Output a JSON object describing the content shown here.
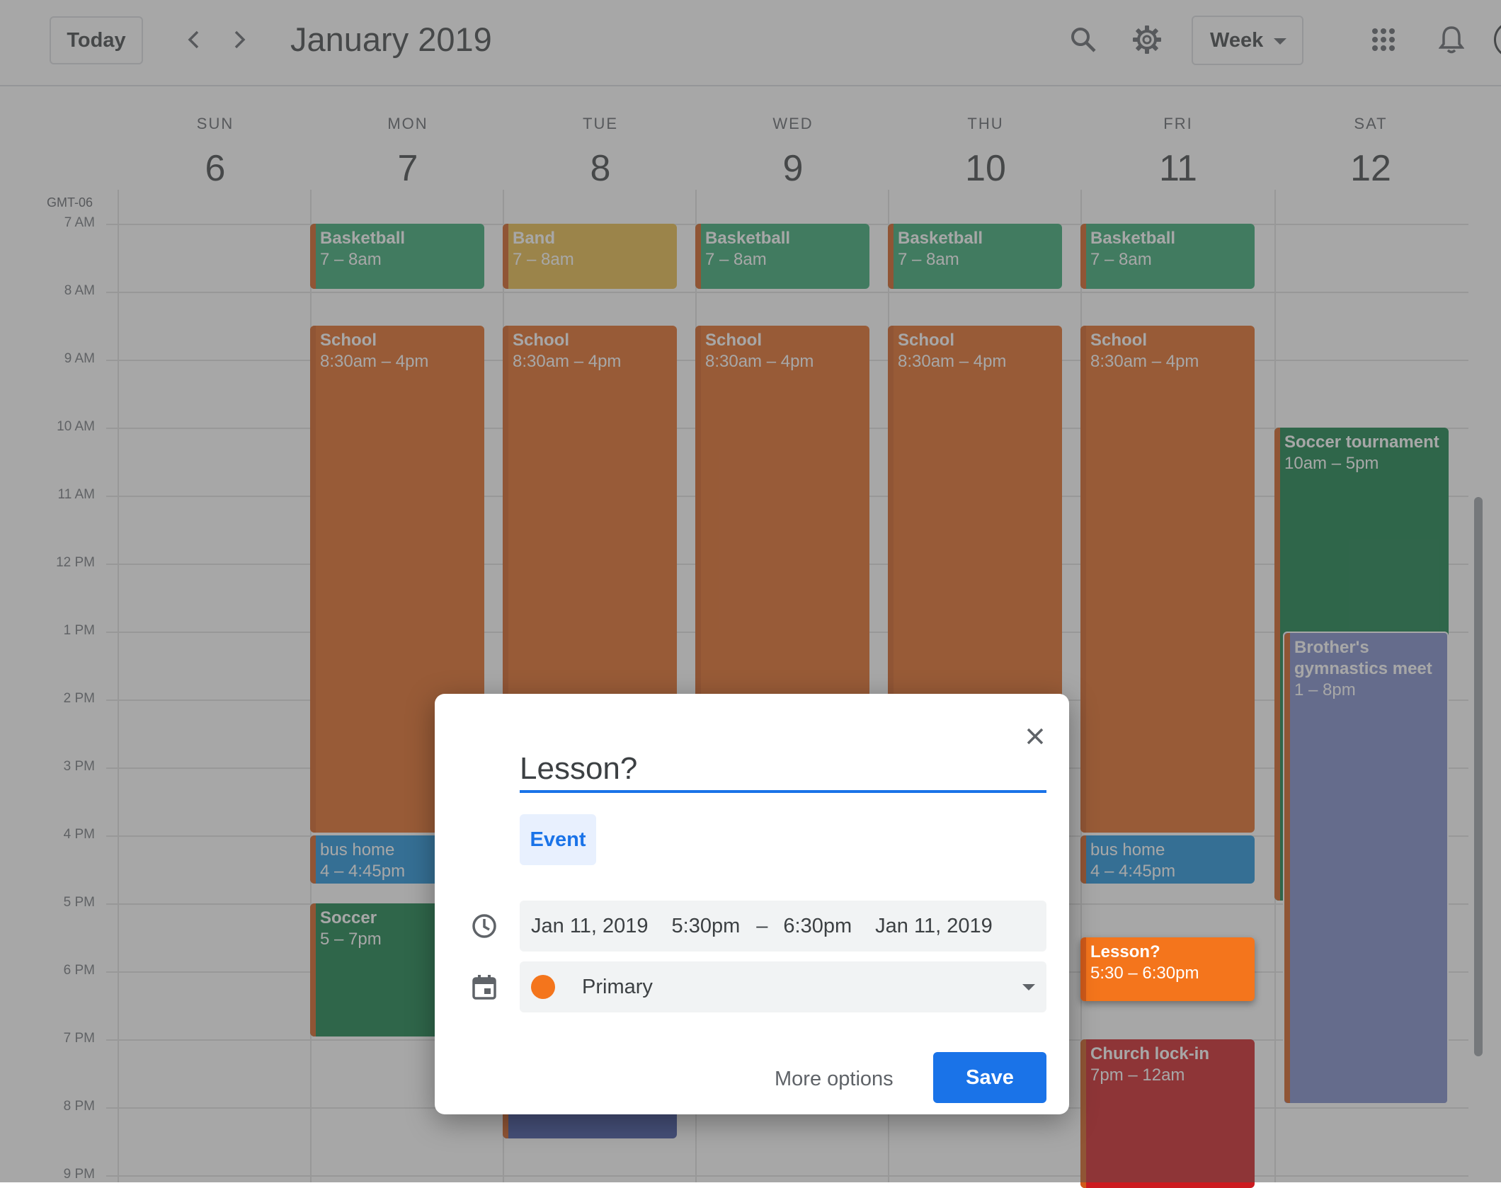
{
  "header": {
    "today_label": "Today",
    "title": "January 2019",
    "view_label": "Week"
  },
  "timezone": "GMT-06",
  "days": [
    {
      "name": "SUN",
      "num": "6"
    },
    {
      "name": "MON",
      "num": "7"
    },
    {
      "name": "TUE",
      "num": "8"
    },
    {
      "name": "WED",
      "num": "9"
    },
    {
      "name": "THU",
      "num": "10"
    },
    {
      "name": "FRI",
      "num": "11"
    },
    {
      "name": "SAT",
      "num": "12"
    }
  ],
  "hours": [
    "7 AM",
    "8 AM",
    "9 AM",
    "10 AM",
    "11 AM",
    "12 PM",
    "1 PM",
    "2 PM",
    "3 PM",
    "4 PM",
    "5 PM",
    "6 PM",
    "7 PM",
    "8 PM",
    "9 PM"
  ],
  "events": {
    "mon_basketball": {
      "title": "Basketball",
      "time": "7 – 8am"
    },
    "tue_band": {
      "title": "Band",
      "time": "7 – 8am"
    },
    "wed_basketball": {
      "title": "Basketball",
      "time": "7 – 8am"
    },
    "thu_basketball": {
      "title": "Basketball",
      "time": "7 – 8am"
    },
    "fri_basketball": {
      "title": "Basketball",
      "time": "7 – 8am"
    },
    "mon_school": {
      "title": "School",
      "time": "8:30am – 4pm"
    },
    "tue_school": {
      "title": "School",
      "time": "8:30am – 4pm"
    },
    "wed_school": {
      "title": "School",
      "time": "8:30am – 4pm"
    },
    "thu_school": {
      "title": "School",
      "time": "8:30am – 4pm"
    },
    "fri_school": {
      "title": "School",
      "time": "8:30am – 4pm"
    },
    "sat_soccer_tournament": {
      "title": "Soccer tournament",
      "time": "10am – 5pm"
    },
    "sat_gymnastics": {
      "title": "Brother's gymnastics meet",
      "time": "1 – 8pm"
    },
    "mon_bus_home": {
      "title": "bus home",
      "time": "4 – 4:45pm"
    },
    "fri_bus_home": {
      "title": "bus home",
      "time": "4 – 4:45pm"
    },
    "mon_soccer": {
      "title": "Soccer",
      "time": "5 – 7pm"
    },
    "fri_lesson": {
      "title": "Lesson?",
      "time": "5:30 – 6:30pm"
    },
    "fri_church": {
      "title": "Church lock-in",
      "time": "7pm – 12am"
    }
  },
  "dialog": {
    "title_value": "Lesson?",
    "tab_label": "Event",
    "start_date": "Jan 11, 2019",
    "start_time": "5:30pm",
    "dash": "–",
    "end_time": "6:30pm",
    "end_date": "Jan 11, 2019",
    "calendar": "Primary",
    "more_options_label": "More options",
    "save_label": "Save"
  },
  "colors": {
    "accent": "#1a73e8",
    "basketball": "#33a670",
    "band": "#e6b945",
    "school": "#e0661f",
    "soccer_dark": "#0f7d45",
    "gymnastics": "#7b88c9",
    "bus": "#1b8fd8",
    "lesson": "#f4751c",
    "church": "#cc1a1f",
    "hidden_tue": "#3a4ea0"
  }
}
